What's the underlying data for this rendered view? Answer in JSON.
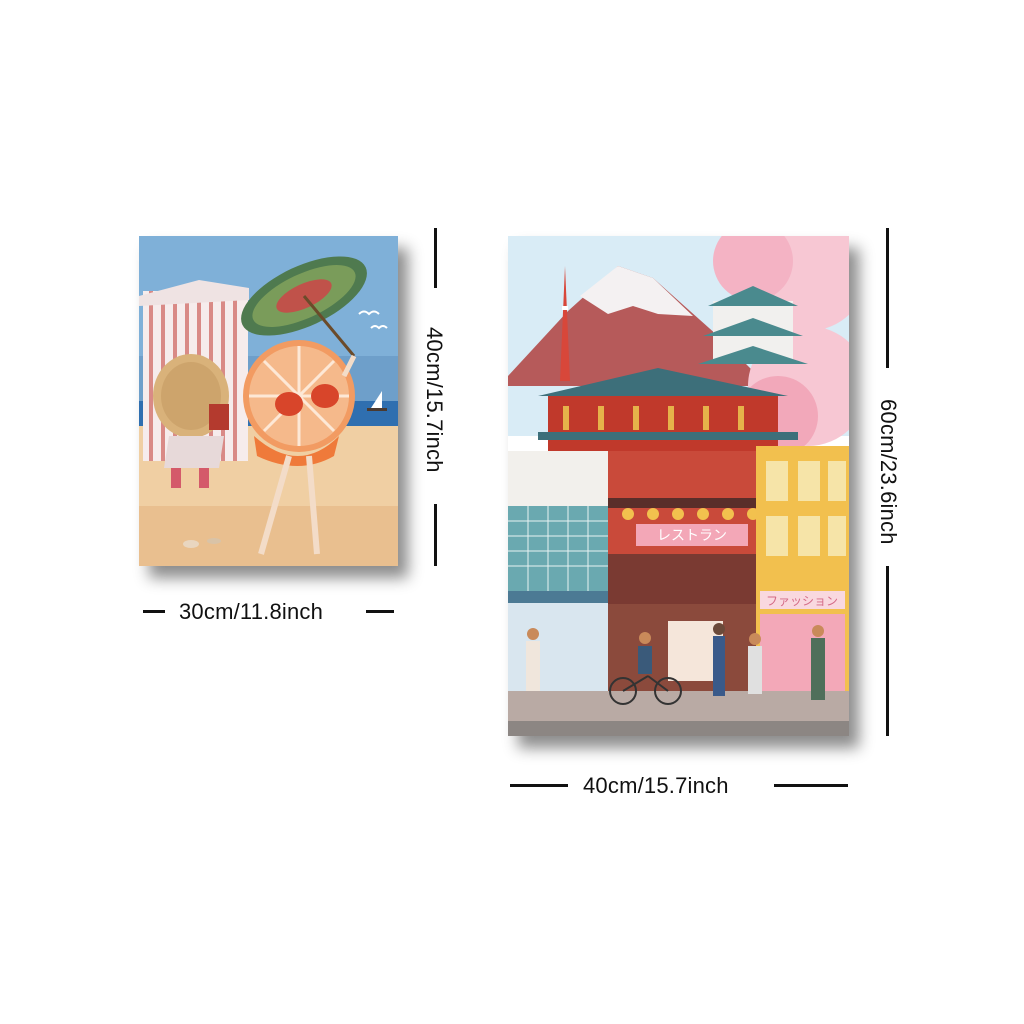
{
  "posters": [
    {
      "id": "left",
      "width_label": "30cm/11.8inch",
      "height_label": "40cm/15.7inch"
    },
    {
      "id": "right",
      "width_label": "40cm/15.7inch",
      "height_label": "60cm/23.6inch",
      "signs": {
        "restaurant": "レストラン",
        "fashion": "ファッション"
      }
    }
  ],
  "colors": {
    "background": "#ffffff",
    "dimension_ink": "#111111",
    "sky_left": "#7fb0d8",
    "sand": "#f0cfa3",
    "orange": "#f0955a",
    "sky_right": "#d9ecf6",
    "sakura": "#f7c7d3",
    "temple_red": "#c0392b"
  }
}
